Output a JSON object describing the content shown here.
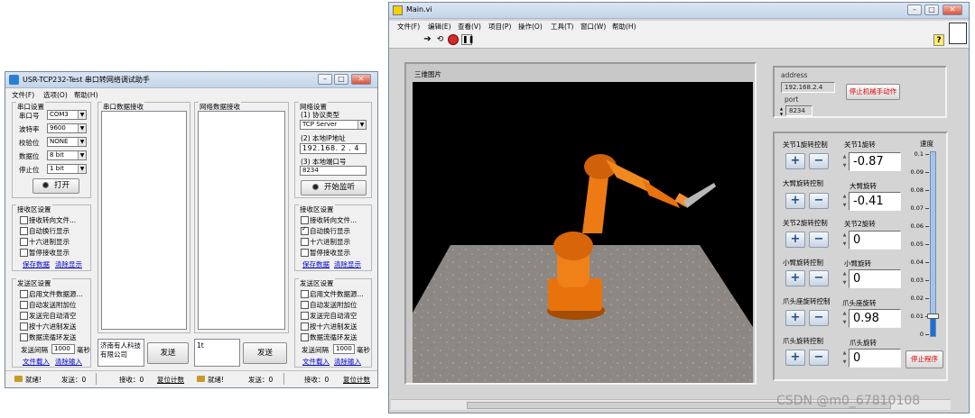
{
  "usr_window": {
    "title": "USR-TCP232-Test 串口转网络调试助手",
    "menu": [
      "文件(F)",
      "选项(O)",
      "帮助(H)"
    ],
    "serial_settings": {
      "title": "串口设置",
      "fields": [
        {
          "label": "串口号",
          "value": "COM3"
        },
        {
          "label": "波特率",
          "value": "9600"
        },
        {
          "label": "校验位",
          "value": "NONE"
        },
        {
          "label": "数据位",
          "value": "8 bit"
        },
        {
          "label": "停止位",
          "value": "1 bit"
        }
      ],
      "open_button": "打开"
    },
    "recv_settings_left": {
      "title": "接收区设置",
      "options": [
        "接收转向文件...",
        "自动换行显示",
        "十六进制显示",
        "暂停接收显示"
      ],
      "links": [
        "保存数据",
        "清除显示"
      ]
    },
    "send_settings_left": {
      "title": "发送区设置",
      "options": [
        "启用文件数据源...",
        "自动发送附加位",
        "发送完自动清空",
        "按十六进制发送",
        "数据流循环发送"
      ],
      "interval_label": "发送间隔",
      "interval_value": "1000",
      "interval_unit": "毫秒",
      "links": [
        "文件载入",
        "清除输入"
      ]
    },
    "serial_recv_title": "串口数据接收",
    "net_recv_title": "网络数据接收",
    "serial_send_text": "济南有人科技有限公司",
    "net_send_text": "1t",
    "send_button_1": "发送",
    "send_button_2": "发送",
    "net_settings": {
      "title": "网络设置",
      "protocol_label": "(1) 协议类型",
      "protocol_value": "TCP Server",
      "ip_label": "(2) 本地IP地址",
      "ip_value": "192.168. 2 . 4",
      "port_label": "(3) 本地端口号",
      "port_value": "8234",
      "listen_button": "开始监听"
    },
    "recv_settings_right": {
      "title": "接收区设置",
      "options": [
        "接收转向文件...",
        "自动换行显示",
        "十六进制显示",
        "暂停接收显示"
      ],
      "checked_index": 1,
      "links": [
        "保存数据",
        "清除显示"
      ]
    },
    "send_settings_right": {
      "title": "发送区设置",
      "options": [
        "启用文件数据源...",
        "自动发送附加位",
        "发送完自动清空",
        "按十六进制发送",
        "数据流循环发送"
      ],
      "interval_label": "发送间隔",
      "interval_value": "1000",
      "interval_unit": "毫秒",
      "links": [
        "文件载入",
        "清除输入"
      ]
    },
    "status_left": {
      "ready": "就绪!",
      "send": "发送：0",
      "recv": "接收：0",
      "reset": "复位计数"
    },
    "status_right": {
      "ready": "就绪!",
      "send": "发送：0",
      "recv": "接收：0",
      "reset": "复位计数"
    }
  },
  "labview_window": {
    "title": "Main.vi",
    "menu": [
      "文件(F)",
      "编辑(E)",
      "查看(V)",
      "项目(P)",
      "操作(O)",
      "工具(T)",
      "窗口(W)",
      "帮助(H)"
    ],
    "picture_label": "三维图片",
    "address_label": "address",
    "address_value": "192.168.2.4",
    "port_label": "port",
    "port_value": "8234",
    "stop_robot_button": "停止机械手动作",
    "joints": [
      {
        "control_label": "关节1旋转控制",
        "value_label": "关节1旋转",
        "value": "-0.87"
      },
      {
        "control_label": "大臂旋转控制",
        "value_label": "大臂旋转",
        "value": "-0.41"
      },
      {
        "control_label": "关节2旋转控制",
        "value_label": "关节2旋转",
        "value": "0"
      },
      {
        "control_label": "小臂旋转控制",
        "value_label": "小臂旋转",
        "value": "0"
      },
      {
        "control_label": "爪头座旋转控制",
        "value_label": "爪头座旋转",
        "value": "0.98"
      },
      {
        "control_label": "爪头旋转控制",
        "value_label": "爪头旋转",
        "value": "0"
      }
    ],
    "speed_label": "速度",
    "speed_ticks": [
      "0.1",
      "0.09",
      "0.08",
      "0.07",
      "0.06",
      "0.05",
      "0.04",
      "0.03",
      "0.02",
      "0.01",
      "0"
    ],
    "speed_value": 0.01,
    "stop_program_button": "停止程序",
    "colors": {
      "robot": "#e8720c",
      "floor": "#8a8580",
      "stop_text": "#e00000",
      "slider_fill": "#1e6fd0"
    }
  },
  "watermark": "CSDN @m0_67810108"
}
